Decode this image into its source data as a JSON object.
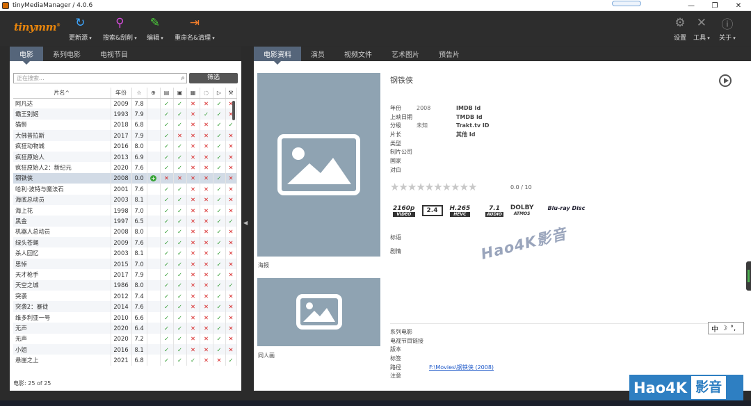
{
  "window": {
    "title": "tinyMediaManager / 4.0.6",
    "min": "—",
    "max": "❐",
    "close": "✕"
  },
  "toolbar": {
    "logo": "tinymm",
    "update": "更新源",
    "search": "搜索&刮削",
    "edit": "编辑",
    "rename": "重命名&清理",
    "settings": "设置",
    "tools": "工具",
    "about": "关于"
  },
  "left_tabs": [
    "电影",
    "系列电影",
    "电视节目"
  ],
  "right_tabs": [
    "电影资料",
    "演员",
    "视频文件",
    "艺术图片",
    "预告片"
  ],
  "search": {
    "placeholder": "正在搜索...",
    "filter_label": "筛选"
  },
  "columns": {
    "name": "片名^",
    "year": "年份"
  },
  "movies": [
    {
      "name": "阿凡达",
      "year": "2009",
      "rating": "7.8",
      "f": [
        "ok",
        "ok",
        "no",
        "no",
        "ok",
        "no"
      ]
    },
    {
      "name": "霸王别姬",
      "year": "1993",
      "rating": "7.9",
      "f": [
        "ok",
        "ok",
        "no",
        "ok",
        "ok",
        "no"
      ]
    },
    {
      "name": "猫鬃",
      "year": "2018",
      "rating": "6.8",
      "f": [
        "ok",
        "ok",
        "no",
        "no",
        "ok",
        "ok"
      ]
    },
    {
      "name": "大佛普拉斯",
      "year": "2017",
      "rating": "7.9",
      "f": [
        "ok",
        "no",
        "no",
        "no",
        "ok",
        "no"
      ]
    },
    {
      "name": "疯狂动物城",
      "year": "2016",
      "rating": "8.0",
      "f": [
        "ok",
        "ok",
        "no",
        "no",
        "ok",
        "no"
      ]
    },
    {
      "name": "疯狂原始人",
      "year": "2013",
      "rating": "6.9",
      "f": [
        "ok",
        "ok",
        "no",
        "no",
        "ok",
        "no"
      ]
    },
    {
      "name": "疯狂原始人2：新纪元",
      "year": "2020",
      "rating": "7.6",
      "f": [
        "ok",
        "ok",
        "no",
        "no",
        "ok",
        "no"
      ]
    },
    {
      "name": "钢铁侠",
      "year": "2008",
      "rating": "0.0",
      "f": [
        "plus",
        "no",
        "no",
        "no",
        "no",
        "ok",
        "no"
      ]
    },
    {
      "name": "哈利·波特与魔法石",
      "year": "2001",
      "rating": "7.6",
      "f": [
        "ok",
        "ok",
        "no",
        "no",
        "ok",
        "no"
      ]
    },
    {
      "name": "海底总动员",
      "year": "2003",
      "rating": "8.1",
      "f": [
        "ok",
        "ok",
        "no",
        "no",
        "ok",
        "no"
      ]
    },
    {
      "name": "海上花",
      "year": "1998",
      "rating": "7.0",
      "f": [
        "ok",
        "ok",
        "no",
        "no",
        "ok",
        "no"
      ]
    },
    {
      "name": "黑金",
      "year": "1997",
      "rating": "6.5",
      "f": [
        "ok",
        "ok",
        "no",
        "no",
        "ok",
        "ok"
      ]
    },
    {
      "name": "机器人总动员",
      "year": "2008",
      "rating": "8.0",
      "f": [
        "ok",
        "ok",
        "no",
        "no",
        "ok",
        "no"
      ]
    },
    {
      "name": "绿头苍蝇",
      "year": "2009",
      "rating": "7.6",
      "f": [
        "ok",
        "ok",
        "no",
        "no",
        "ok",
        "no"
      ]
    },
    {
      "name": "杀人回忆",
      "year": "2003",
      "rating": "8.1",
      "f": [
        "ok",
        "ok",
        "no",
        "no",
        "ok",
        "no"
      ]
    },
    {
      "name": "思悼",
      "year": "2015",
      "rating": "7.0",
      "f": [
        "ok",
        "ok",
        "no",
        "no",
        "ok",
        "no"
      ]
    },
    {
      "name": "天才枪手",
      "year": "2017",
      "rating": "7.9",
      "f": [
        "ok",
        "ok",
        "no",
        "no",
        "ok",
        "no"
      ]
    },
    {
      "name": "天空之城",
      "year": "1986",
      "rating": "8.0",
      "f": [
        "ok",
        "ok",
        "no",
        "no",
        "ok",
        "ok"
      ]
    },
    {
      "name": "突袭",
      "year": "2012",
      "rating": "7.4",
      "f": [
        "ok",
        "ok",
        "no",
        "no",
        "ok",
        "no"
      ]
    },
    {
      "name": "突袭2：暴徒",
      "year": "2014",
      "rating": "7.6",
      "f": [
        "ok",
        "ok",
        "no",
        "no",
        "ok",
        "no"
      ]
    },
    {
      "name": "维多利亚一号",
      "year": "2010",
      "rating": "6.6",
      "f": [
        "ok",
        "ok",
        "no",
        "no",
        "ok",
        "no"
      ]
    },
    {
      "name": "无声",
      "year": "2020",
      "rating": "6.4",
      "f": [
        "ok",
        "ok",
        "no",
        "no",
        "ok",
        "no"
      ]
    },
    {
      "name": "无声",
      "year": "2020",
      "rating": "7.2",
      "f": [
        "ok",
        "ok",
        "no",
        "no",
        "ok",
        "no"
      ]
    },
    {
      "name": "小姐",
      "year": "2016",
      "rating": "8.1",
      "f": [
        "ok",
        "ok",
        "no",
        "no",
        "ok",
        "no"
      ]
    },
    {
      "name": "悬崖之上",
      "year": "2021",
      "rating": "6.8",
      "f": [
        "ok",
        "ok",
        "ok",
        "no",
        "no",
        "ok"
      ]
    }
  ],
  "status": "电影:  25  of  25",
  "detail": {
    "title": "钢铁侠",
    "labels": [
      "年份",
      "上映日期",
      "分级",
      "片长",
      "类型",
      "制片公司",
      "国家",
      "对白"
    ],
    "values": [
      "2008",
      "",
      "未知"
    ],
    "ids": [
      "IMDB Id",
      "TMDB Id",
      "Trakt.tv ID",
      "其他 Id"
    ],
    "stars": "★★★★★★★★★★",
    "rating": "0.0 / 10",
    "tagline_label": "标语",
    "plot_label": "剧情",
    "poster_label": "海报",
    "fanart_label": "同人画",
    "bottom_labels": [
      "系列电影",
      "电视节目链接",
      "版本",
      "标签",
      "路径",
      "注意"
    ],
    "path": "F:\\Movies\\钢铁侠 (2008)"
  },
  "badges": {
    "res": "2160p",
    "res_sub": "VIDEO",
    "aspect": "2.4",
    "codec": "H.265",
    "codec_sub": "HEVC",
    "audio": "7.1",
    "audio_sub": "AUDIO",
    "dolby": "DOLBY",
    "dolby_sub": "ATMOS",
    "bluray": "Blu-ray Disc"
  },
  "watermark": "Hao4K影音",
  "ime": {
    "lang": "中",
    "moon": "☽",
    "dot": "°,"
  },
  "brand": {
    "left": "Hao4K",
    "right": "影音"
  },
  "colors": {
    "accent": "#e8850c",
    "tab_active": "#55657a",
    "ok": "#2e9a2e",
    "no": "#d61f1f",
    "placeholder": "#8fa3b2"
  }
}
